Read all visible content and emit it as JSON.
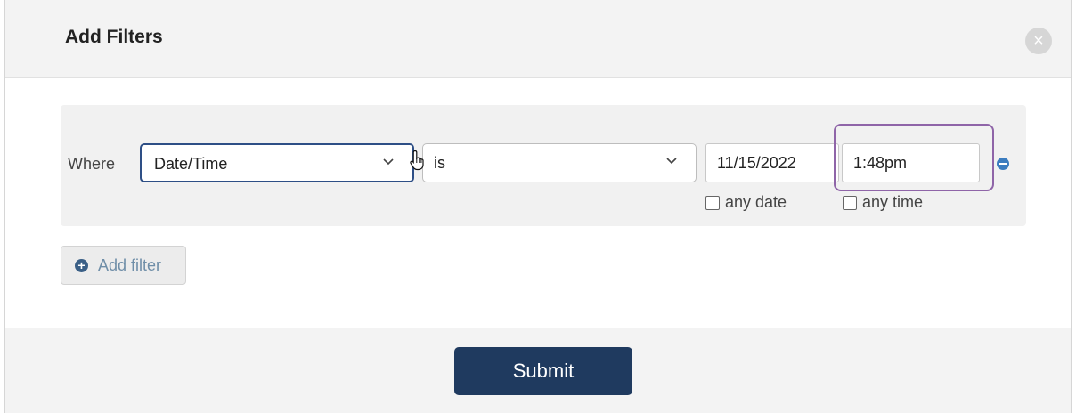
{
  "dialog": {
    "title": "Add Filters",
    "close_icon": "close-icon"
  },
  "filter_row": {
    "where_label": "Where",
    "field_select": {
      "selected": "Date/Time",
      "icon": "chevron-down-icon"
    },
    "operator_select": {
      "selected": "is",
      "icon": "chevron-down-icon"
    },
    "date_input": {
      "value": "11/15/2022"
    },
    "time_input": {
      "value": "1:48pm"
    },
    "any_date_checkbox": {
      "label": "any date",
      "checked": false
    },
    "any_time_checkbox": {
      "label": "any time",
      "checked": false
    },
    "remove_icon": "minus-circle-icon"
  },
  "add_filter": {
    "label": "Add filter",
    "icon": "plus-circle-icon"
  },
  "footer": {
    "submit_label": "Submit"
  },
  "colors": {
    "accent": "#2e4f86",
    "submit_bg": "#1f3a5f",
    "highlight": "#8f65a8"
  }
}
